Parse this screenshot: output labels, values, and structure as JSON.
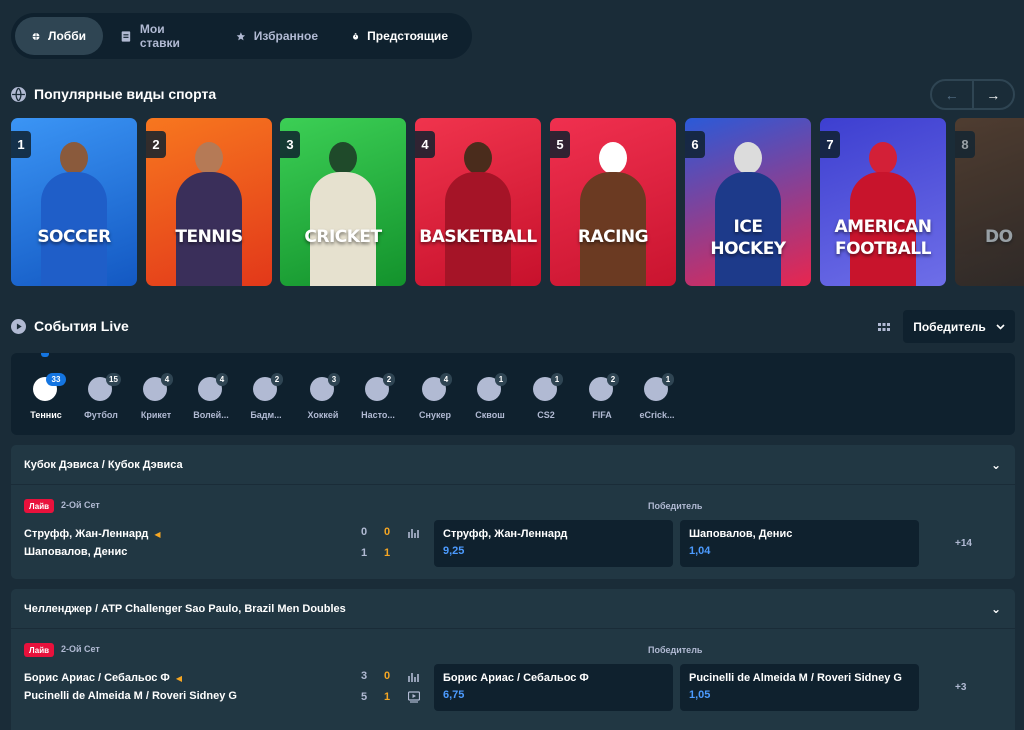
{
  "tabs": [
    {
      "label": "Лобби",
      "icon": "lobby-icon"
    },
    {
      "label": "Мои ставки",
      "icon": "bets-icon"
    },
    {
      "label": "Избранное",
      "icon": "star-icon"
    },
    {
      "label": "Предстоящие",
      "icon": "stopwatch-icon"
    }
  ],
  "popular": {
    "title": "Популярные виды спорта",
    "prev": "←",
    "next": "→",
    "cards": [
      {
        "num": "1",
        "label": "SOCCER",
        "bg": "#1f7be0"
      },
      {
        "num": "2",
        "label": "TENNIS",
        "bg": "#f0561c"
      },
      {
        "num": "3",
        "label": "CRICKET",
        "bg": "#1fb83f"
      },
      {
        "num": "4",
        "label": "BASKETBALL",
        "bg": "#e8203f"
      },
      {
        "num": "5",
        "label": "RACING",
        "bg": "#e51a3d"
      },
      {
        "num": "6",
        "label_1": "ICE",
        "label_2": "HOCKEY",
        "bg": "#e62a55"
      },
      {
        "num": "7",
        "label_1": "AMERICAN",
        "label_2": "FOOTBALL",
        "bg": "#4a5bd8"
      },
      {
        "num": "8",
        "label": "DO",
        "bg": "#5a3a2a"
      }
    ]
  },
  "live": {
    "title": "События Live",
    "dropdown": "Победитель"
  },
  "filters": [
    {
      "name": "Теннис",
      "count": "33"
    },
    {
      "name": "Футбол",
      "count": "15"
    },
    {
      "name": "Крикет",
      "count": "4"
    },
    {
      "name": "Волей...",
      "count": "4"
    },
    {
      "name": "Бадм...",
      "count": "2"
    },
    {
      "name": "Хоккей",
      "count": "3"
    },
    {
      "name": "Насто...",
      "count": "2"
    },
    {
      "name": "Снукер",
      "count": "4"
    },
    {
      "name": "Сквош",
      "count": "1"
    },
    {
      "name": "CS2",
      "count": "1"
    },
    {
      "name": "FIFA",
      "count": "2"
    },
    {
      "name": "eCrick...",
      "count": "1"
    }
  ],
  "matches": [
    {
      "league": "Кубок Дэвиса / Кубок Дэвиса",
      "live": "Лайв",
      "set": "2-Ой Сет",
      "market": "Победитель",
      "p1": "Струфф, Жан-Леннард",
      "p2": "Шаповалов, Денис",
      "s1a": "0",
      "s1b": "0",
      "s2a": "1",
      "s2b": "1",
      "o1_name": "Струфф, Жан-Леннард",
      "o1_val": "9,25",
      "o2_name": "Шаповалов, Денис",
      "o2_val": "1,04",
      "more": "+14"
    },
    {
      "league": "Челленджер / ATP Challenger Sao Paulo, Brazil Men Doubles",
      "live": "Лайв",
      "set": "2-Ой Сет",
      "market": "Победитель",
      "p1": "Борис Ариас / Себальос Ф",
      "p2": "Pucinelli de Almeida M / Roveri Sidney G",
      "s1a": "3",
      "s1b": "0",
      "s2a": "5",
      "s2b": "1",
      "o1_name": "Борис Ариас / Себальос Ф",
      "o1_val": "6,75",
      "o2_name": "Pucinelli de Almeida M / Roveri Sidney G",
      "o2_val": "1,05",
      "more": "+3"
    }
  ]
}
